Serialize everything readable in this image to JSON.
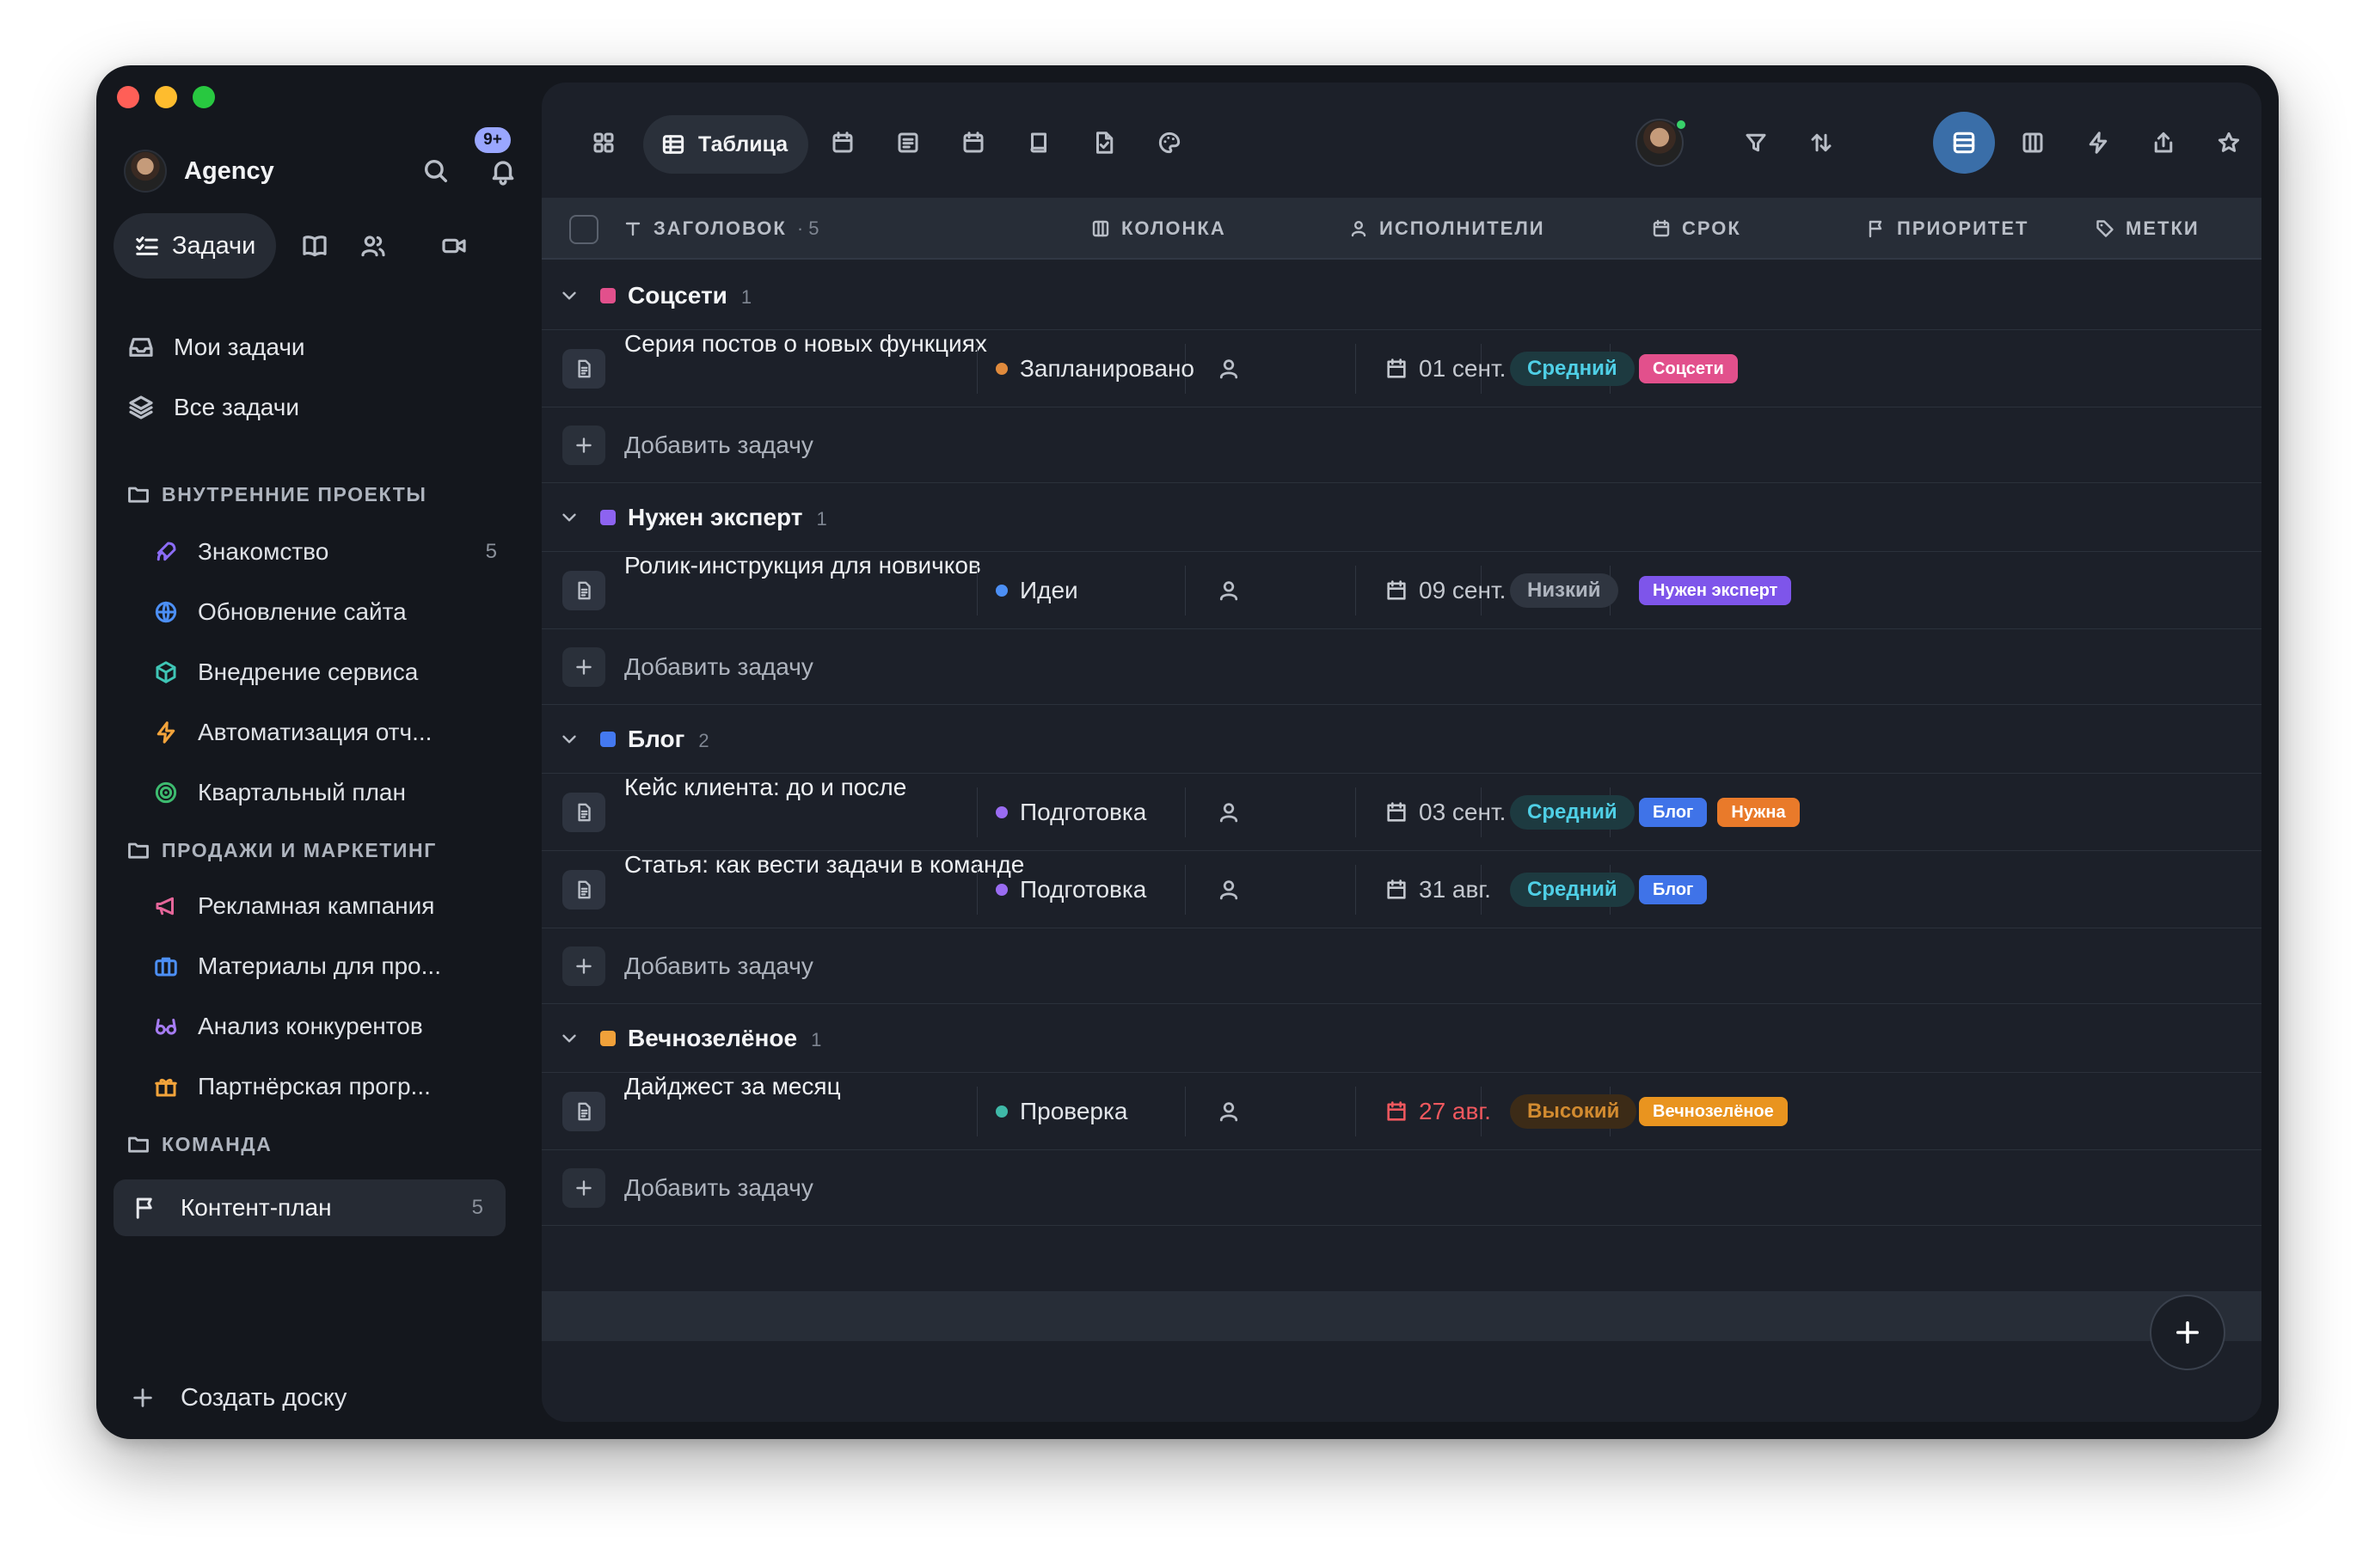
{
  "window": {
    "traffic_lights": [
      "close",
      "minimize",
      "maximize"
    ]
  },
  "sidebar": {
    "workspace": {
      "name": "Agency",
      "notifications_badge": "9+"
    },
    "nav": {
      "active_label": "Задачи",
      "icons": [
        "checklist-icon",
        "book-icon",
        "people-icon",
        "video-icon"
      ]
    },
    "top_items": [
      {
        "label": "Мои задачи",
        "icon": "inbox-icon"
      },
      {
        "label": "Все задачи",
        "icon": "layers-icon"
      }
    ],
    "folders": [
      {
        "label": "ВНУТРЕННИЕ ПРОЕКТЫ",
        "projects": [
          {
            "label": "Знакомство",
            "count": "5",
            "icon": "rocket-icon",
            "color": "#8b6cf6"
          },
          {
            "label": "Обновление сайта",
            "count": "",
            "icon": "globe-icon",
            "color": "#4c8ff5"
          },
          {
            "label": "Внедрение сервиса",
            "count": "",
            "icon": "cube-icon",
            "color": "#3fc6b6"
          },
          {
            "label": "Автоматизация отч...",
            "count": "",
            "icon": "bolt-icon",
            "color": "#f3a43b"
          },
          {
            "label": "Квартальный план",
            "count": "",
            "icon": "target-icon",
            "color": "#3dbb6f"
          }
        ]
      },
      {
        "label": "ПРОДАЖИ И МАРКЕТИНГ",
        "projects": [
          {
            "label": "Рекламная кампания",
            "count": "",
            "icon": "megaphone-icon",
            "color": "#e5669a"
          },
          {
            "label": "Материалы для про...",
            "count": "",
            "icon": "briefcase-icon",
            "color": "#4c8ff5"
          },
          {
            "label": "Анализ конкурентов",
            "count": "",
            "icon": "glasses-icon",
            "color": "#a67cf2"
          },
          {
            "label": "Партнёрская прогр...",
            "count": "",
            "icon": "gift-icon",
            "color": "#f3a43b"
          }
        ]
      },
      {
        "label": "КОМАНДА",
        "projects": []
      }
    ],
    "active_board": {
      "label": "Контент-план",
      "count": "5",
      "icon": "flag-icon"
    },
    "create_board": "Создать доску"
  },
  "toolbar": {
    "active_view_label": "Таблица",
    "view_icons": [
      "grid-icon",
      "table-icon",
      "calendar-icon",
      "list-icon",
      "calendar-icon",
      "book-icon",
      "doc-check-icon",
      "palette-icon"
    ],
    "action_icons": [
      "avatar",
      "filter-icon",
      "sort-icon",
      "rows-icon",
      "columns-icon",
      "bolt-icon",
      "share-icon",
      "star-icon",
      "archive-icon"
    ]
  },
  "table": {
    "headers": {
      "title": "ЗАГОЛОВОК",
      "title_count": "· 5",
      "column": "КОЛОНКА",
      "assignees": "ИСПОЛНИТЕЛИ",
      "due": "СРОК",
      "priority": "ПРИОРИТЕТ",
      "tags": "МЕТКИ"
    },
    "add_task_label": "Добавить задачу",
    "groups": [
      {
        "name": "Соцсети",
        "count": "1",
        "color": "#e2508c",
        "tasks": [
          {
            "title": "Серия постов о новых функциях",
            "status": "Запланировано",
            "status_color": "#e08a3c",
            "due": "01 сент.",
            "overdue": false,
            "priority": "Средний",
            "priority_level": "mid",
            "tags": [
              {
                "label": "Соцсети",
                "color": "#e2508c"
              }
            ]
          }
        ]
      },
      {
        "name": "Нужен эксперт",
        "count": "1",
        "color": "#8d63f0",
        "tasks": [
          {
            "title": "Ролик-инструкция для новичков",
            "status": "Идеи",
            "status_color": "#4c8ff5",
            "due": "09 сент.",
            "overdue": false,
            "priority": "Низкий",
            "priority_level": "low",
            "tags": [
              {
                "label": "Нужен эксперт",
                "color": "#7e55ea"
              }
            ]
          }
        ]
      },
      {
        "name": "Блог",
        "count": "2",
        "color": "#4479f0",
        "tasks": [
          {
            "title": "Кейс клиента: до и после",
            "status": "Подготовка",
            "status_color": "#9a6cf2",
            "due": "03 сент.",
            "overdue": false,
            "priority": "Средний",
            "priority_level": "mid",
            "tags": [
              {
                "label": "Блог",
                "color": "#3f73e8"
              },
              {
                "label": "Нужна",
                "color": "#e97a2a"
              }
            ]
          },
          {
            "title": "Статья: как вести задачи в команде",
            "status": "Подготовка",
            "status_color": "#9a6cf2",
            "due": "31 авг.",
            "overdue": false,
            "priority": "Средний",
            "priority_level": "mid",
            "tags": [
              {
                "label": "Блог",
                "color": "#3f73e8"
              }
            ]
          }
        ]
      },
      {
        "name": "Вечнозелёное",
        "count": "1",
        "color": "#f0a13a",
        "tasks": [
          {
            "title": "Дайджест за месяц",
            "status": "Проверка",
            "status_color": "#3fb9a8",
            "due": "27 авг.",
            "overdue": true,
            "priority": "Высокий",
            "priority_level": "high",
            "tags": [
              {
                "label": "Вечнозелёное",
                "color": "#e9941f"
              }
            ]
          }
        ]
      }
    ]
  }
}
